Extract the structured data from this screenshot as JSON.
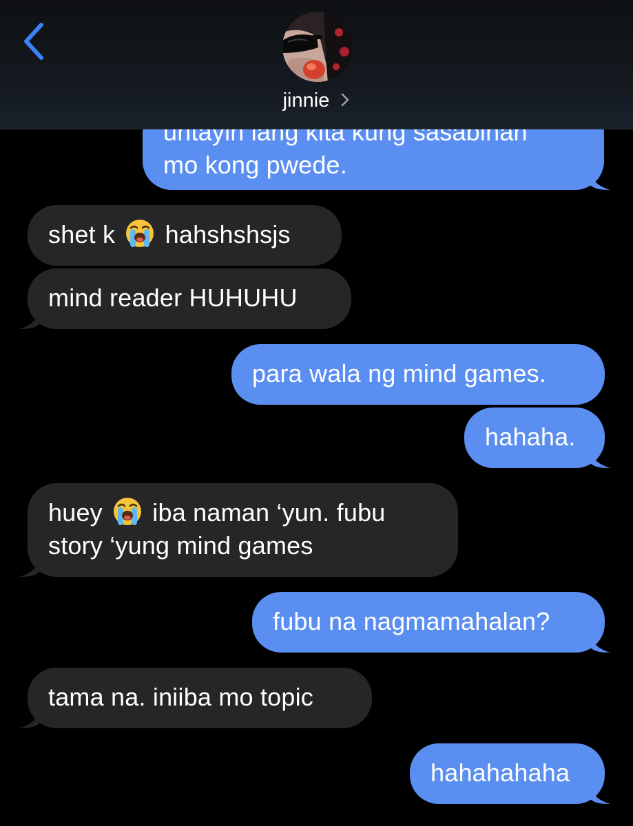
{
  "header": {
    "contact_name": "jinnie",
    "back_icon": "chevron-left-icon",
    "contact_chevron_icon": "chevron-right-icon",
    "accent_color": "#3a82f7"
  },
  "messages": [
    {
      "sender": "me",
      "lines": [
        "untayin lang kita kung sasabihan",
        "mo kong pwede."
      ]
    },
    {
      "sender": "them",
      "text_before": "shet k",
      "emoji": "loudly-crying-face",
      "text_after": "hahshshsjs"
    },
    {
      "sender": "them",
      "text": "mind reader HUHUHU"
    },
    {
      "sender": "me",
      "text": "para wala ng mind games."
    },
    {
      "sender": "me",
      "text": "hahaha."
    },
    {
      "sender": "them",
      "line1_before": "huey",
      "emoji": "loudly-crying-face",
      "line1_after": "iba naman ‘yun. fubu",
      "line2": "story ‘yung mind games"
    },
    {
      "sender": "me",
      "text": "fubu na nagmamahalan?"
    },
    {
      "sender": "them",
      "text": "tama na. iniiba mo topic"
    },
    {
      "sender": "me",
      "text": "hahahahaha"
    }
  ],
  "colors": {
    "outgoing_bubble": "#5b8ef1",
    "incoming_bubble": "#262628",
    "background": "#000000"
  }
}
